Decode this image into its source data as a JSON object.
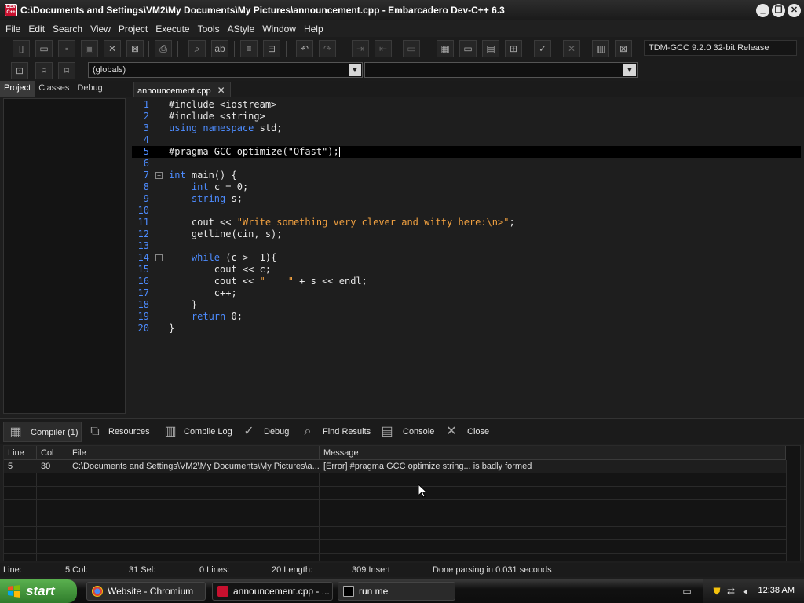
{
  "window": {
    "title": "C:\\Documents and Settings\\VM2\\My Documents\\My Pictures\\announcement.cpp - Embarcadero Dev-C++ 6.3",
    "icon_text": "DEV C++",
    "controls": [
      "_",
      "❐",
      "✕"
    ]
  },
  "menu": [
    "File",
    "Edit",
    "Search",
    "View",
    "Project",
    "Execute",
    "Tools",
    "AStyle",
    "Window",
    "Help"
  ],
  "toolbar": {
    "compiler_select": "TDM-GCC 9.2.0 32-bit Release",
    "scope_select": "(globals)",
    "members_select": ""
  },
  "left_tabs": [
    "Project",
    "Classes",
    "Debug"
  ],
  "editor": {
    "tab_label": "announcement.cpp",
    "tab_close": "✕",
    "active_line": 5,
    "lines": [
      {
        "n": "1",
        "text": "#include <iostream>"
      },
      {
        "n": "2",
        "text": "#include <string>"
      },
      {
        "n": "3",
        "text": "using namespace std;"
      },
      {
        "n": "4",
        "text": ""
      },
      {
        "n": "5",
        "text": "#pragma GCC optimize(\"Ofast\");"
      },
      {
        "n": "6",
        "text": ""
      },
      {
        "n": "7",
        "text": "int main() {"
      },
      {
        "n": "8",
        "text": "    int c = 0;"
      },
      {
        "n": "9",
        "text": "    string s;"
      },
      {
        "n": "10",
        "text": ""
      },
      {
        "n": "11",
        "text": "    cout << \"Write something very clever and witty here:\\n>\";"
      },
      {
        "n": "12",
        "text": "    getline(cin, s);"
      },
      {
        "n": "13",
        "text": ""
      },
      {
        "n": "14",
        "text": "    while (c > -1){"
      },
      {
        "n": "15",
        "text": "        cout << c;"
      },
      {
        "n": "16",
        "text": "        cout << \"    \" + s << endl;"
      },
      {
        "n": "17",
        "text": "        c++;"
      },
      {
        "n": "18",
        "text": "    }"
      },
      {
        "n": "19",
        "text": "    return 0;"
      },
      {
        "n": "20",
        "text": "}"
      }
    ]
  },
  "bottom_tabs": [
    {
      "label": "Compiler (1)",
      "icon": "compiler-icon"
    },
    {
      "label": "Resources",
      "icon": "resources-icon"
    },
    {
      "label": "Compile Log",
      "icon": "compile-log-icon"
    },
    {
      "label": "Debug",
      "icon": "debug-check-icon"
    },
    {
      "label": "Find Results",
      "icon": "find-results-icon"
    },
    {
      "label": "Console",
      "icon": "console-icon"
    },
    {
      "label": "Close",
      "icon": "close-icon"
    }
  ],
  "messages": {
    "columns": [
      "Line",
      "Col",
      "File",
      "Message"
    ],
    "rows": [
      {
        "line": "5",
        "col": "30",
        "file": "C:\\Documents and Settings\\VM2\\My Documents\\My Pictures\\a...",
        "message": "[Error] #pragma GCC optimize string... is badly formed"
      }
    ]
  },
  "status": {
    "line": "Line:",
    "line_val": "5 Col:",
    "col_val": "31 Sel:",
    "sel_val": "0 Lines:",
    "lines_val": "20 Length:",
    "length_val": "309 Insert",
    "message": "Done parsing in 0.031 seconds"
  },
  "taskbar": {
    "start": "start",
    "tasks": [
      "Website - Chromium",
      "announcement.cpp - ...",
      "run me"
    ],
    "clock": "12:38 AM"
  },
  "colors": {
    "keyword": "#4d8cff",
    "string": "#f0a040",
    "line_number": "#4d8cff",
    "start_green": "#3f9a3a"
  }
}
